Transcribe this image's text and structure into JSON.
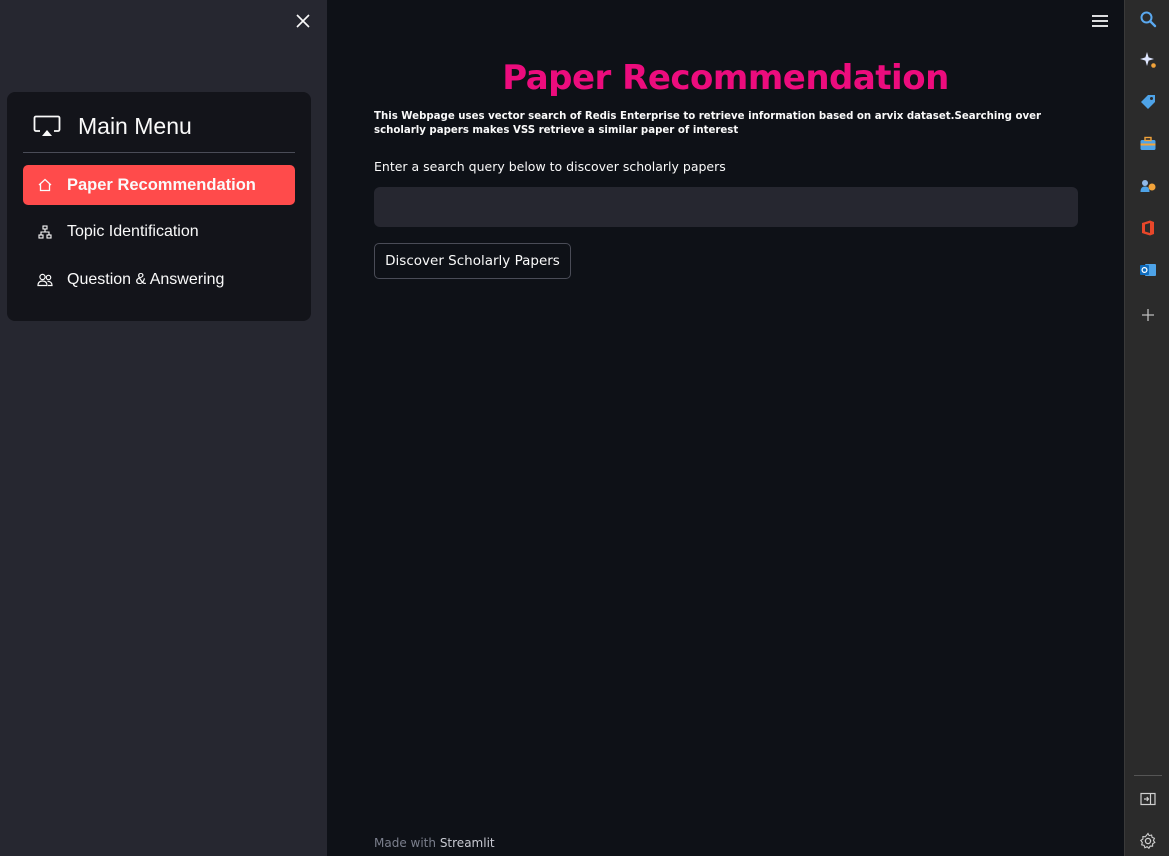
{
  "sidebar": {
    "menu_title": "Main Menu",
    "items": [
      {
        "label": "Paper Recommendation",
        "icon": "house-icon",
        "active": true
      },
      {
        "label": "Topic Identification",
        "icon": "diagram-icon",
        "active": false
      },
      {
        "label": "Question & Answering",
        "icon": "people-icon",
        "active": false
      }
    ]
  },
  "main": {
    "title": "Paper Recommendation",
    "description": "This Webpage uses vector search of Redis Enterprise to retrieve information based on arvix dataset.Searching over scholarly papers makes VSS retrieve a similar paper of interest",
    "query_label": "Enter a search query below to discover scholarly papers",
    "search_value": "",
    "button_label": "Discover Scholarly Papers",
    "footer_prefix": "Made with",
    "footer_brand": "Streamlit"
  },
  "colors": {
    "accent": "#ff4b4b",
    "title": "#ec0c7d",
    "background": "#0e1117",
    "sidebar": "#262730"
  },
  "browser_rail": {
    "icons": [
      "search-icon",
      "copilot-sparkle-icon",
      "shopping-tag-icon",
      "tools-briefcase-icon",
      "games-icon",
      "office-icon",
      "outlook-icon",
      "add-icon",
      "split-screen-icon",
      "settings-gear-icon"
    ]
  }
}
